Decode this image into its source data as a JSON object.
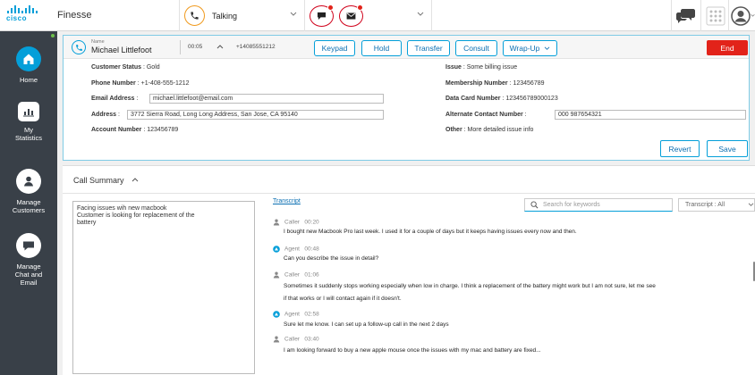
{
  "app": {
    "logo_text": "cisco",
    "title": "Finesse"
  },
  "topbar": {
    "agent_state": "Talking"
  },
  "sidebar": {
    "items": [
      {
        "label_lines": [
          "Home"
        ]
      },
      {
        "label_lines": [
          "My",
          "Statistics"
        ]
      },
      {
        "label_lines": [
          "Manage",
          "Customers"
        ]
      },
      {
        "label_lines": [
          "Manage",
          "Chat and",
          "Email"
        ]
      }
    ]
  },
  "call": {
    "name_label": "Name",
    "name": "Michael Littlefoot",
    "timer": "00:05",
    "phone": "+14085551212",
    "buttons": {
      "keypad": "Keypad",
      "hold": "Hold",
      "transfer": "Transfer",
      "consult": "Consult",
      "wrapup": "Wrap-Up",
      "end": "End"
    }
  },
  "customer": {
    "status_label": "Customer Status",
    "status": "Gold",
    "phone_label": "Phone Number",
    "phone": "+1-408-555-1212",
    "email_label": "Email Address",
    "email": "michael.littlefoot@email.com",
    "address_label": "Address",
    "address": "3772 Sierra Road, Long Long Address, San Jose, CA 95140",
    "account_label": "Account Number",
    "account": "123456789",
    "issue_label": "Issue",
    "issue": "Some billing issue",
    "membership_label": "Membership Number",
    "membership": "123456789",
    "datacard_label": "Data Card Number",
    "datacard": "123456789000123",
    "alt_contact_label": "Alternate Contact Number",
    "alt_contact": "000 987654321",
    "other_label": "Other",
    "other": "More detailed issue info",
    "revert": "Revert",
    "save": "Save"
  },
  "summary": {
    "title": "Call Summary",
    "notes": [
      "Facing issues wih new macbook",
      "Customer is looking for replacement of the",
      "battery"
    ],
    "transcript_tab": "Transcript",
    "search_placeholder": "Search for keywords",
    "filter": "Transcript : All",
    "messages": [
      {
        "speaker": "Caller",
        "time": "00:20",
        "icon": "person-icon",
        "lines": [
          "I bought new Macbook Pro last week. I used it for a couple of days but it keeps having issues every now and then."
        ]
      },
      {
        "speaker": "Agent",
        "time": "00:48",
        "icon": "agent-icon",
        "lines": [
          "Can you describe the issue in detail?"
        ]
      },
      {
        "speaker": "Caller",
        "time": "01:06",
        "icon": "person-icon",
        "lines": [
          "Sometimes it suddenly stops working especially when low in charge. I think a replacement of the battery might work but I am not sure, let me see",
          "if that works or I will contact again if it doesn't."
        ]
      },
      {
        "speaker": "Agent",
        "time": "02:58",
        "icon": "agent-icon",
        "lines": [
          "Sure let me know. I can set up a follow-up call in the next 2 days"
        ]
      },
      {
        "speaker": "Caller",
        "time": "03:40",
        "icon": "person-icon",
        "lines": [
          "I am looking forward to buy a new apple mouse once the issues with my mac and battery are fixed..."
        ]
      }
    ]
  },
  "colors": {
    "accent": "#049fd9",
    "sidebar": "#394048",
    "end": "#e2231a",
    "talking": "#f09a1e"
  }
}
